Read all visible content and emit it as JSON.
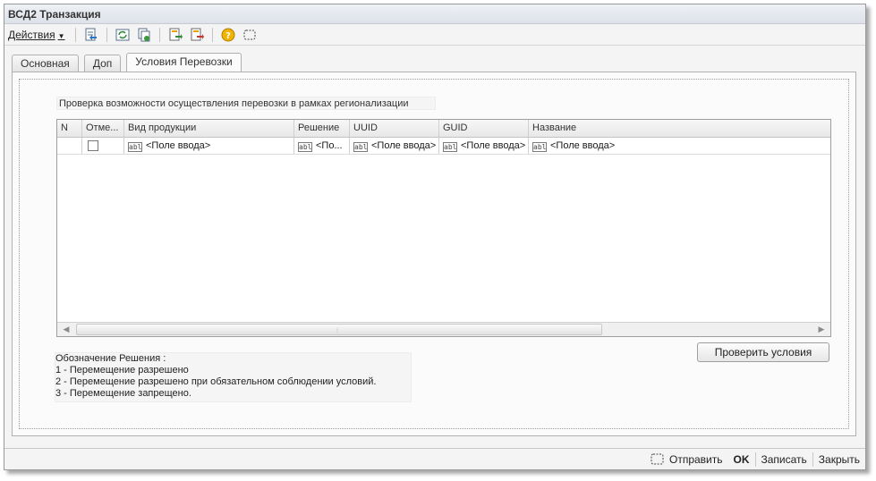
{
  "window": {
    "title": "ВСД2 Транзакция"
  },
  "toolbar": {
    "actions_label": "Действия",
    "buttons": [
      "import-icon",
      "refresh-icon",
      "copy-icon",
      "export-icon",
      "export-red-icon",
      "help-icon",
      "select-area-icon"
    ]
  },
  "tabs": [
    {
      "label": "Основная",
      "active": false
    },
    {
      "label": "Доп",
      "active": false
    },
    {
      "label": "Условия Перевозки",
      "active": true
    }
  ],
  "main": {
    "check_caption": "Проверка возможности осуществления перевозки в рамках регионализации",
    "grid": {
      "columns": [
        "N",
        "Отме...",
        "Вид продукции",
        "Решение",
        "UUID",
        "GUID",
        "Название"
      ],
      "rows": [
        {
          "n": "",
          "checked": false,
          "product": "<Поле ввода>",
          "decision": "<По...",
          "uuid": "<Поле ввода>",
          "guid": "<Поле ввода>",
          "name": "<Поле ввода>"
        }
      ]
    },
    "check_button": "Проверить условия",
    "legend": [
      "Обозначение Решения :",
      "1 - Перемещение разрешено",
      "2 - Перемещение разрешено при обязательном соблюдении условий.",
      "3 - Перемещение запрещено."
    ]
  },
  "footer": {
    "send": "Отправить",
    "ok": "OK",
    "save": "Записать",
    "close": "Закрыть"
  },
  "colors": {
    "window_bg": "#f4f4f4",
    "border": "#9a9a9a",
    "accent": "#e8a200"
  }
}
